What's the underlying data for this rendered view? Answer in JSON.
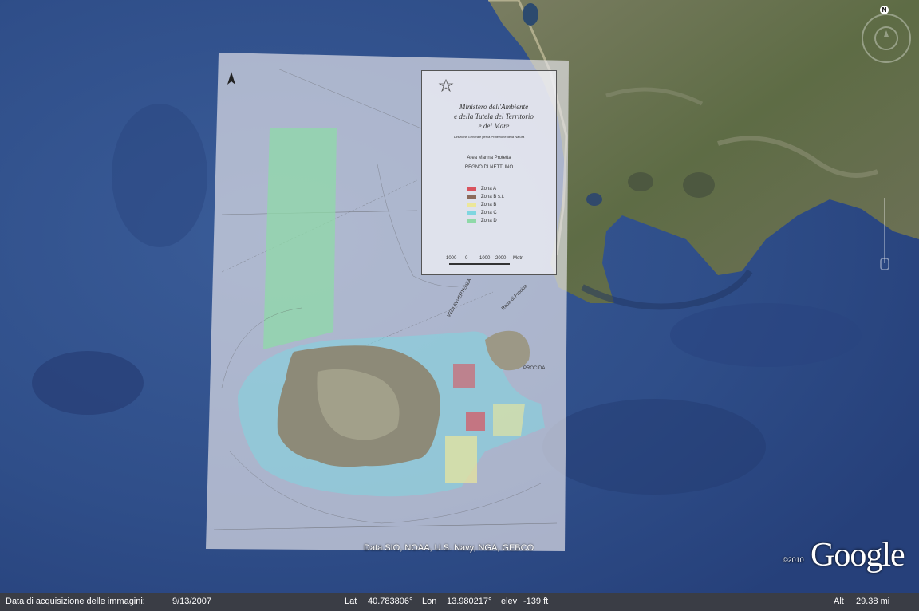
{
  "map": {
    "data_credit": "Data SIO, NOAA, U.S. Navy, NGA, GEBCO",
    "copyright_year": "©2010",
    "brand_logo": "Google",
    "compass_north": "N"
  },
  "nautical_chart": {
    "ministry_title_lines": [
      "Ministero dell'Ambiente",
      "e della Tutela del Territorio",
      "e del Mare"
    ],
    "directorate": "Direzione Generale per la Protezione della Natura",
    "area_label": "Area Marina Protetta",
    "area_name": "REGNO DI NETTUNO",
    "zones": [
      {
        "label": "Zona A",
        "color": "#d9535e"
      },
      {
        "label": "Zona B s.t.",
        "color": "#8b6a5a"
      },
      {
        "label": "Zona B",
        "color": "#ece79a"
      },
      {
        "label": "Zona C",
        "color": "#7fd6e0"
      },
      {
        "label": "Zona D",
        "color": "#8fd9a8"
      }
    ],
    "scale_bar": {
      "ticks": [
        "1000",
        "0",
        "1000",
        "2000"
      ],
      "unit": "Metri"
    },
    "map_labels": [
      "VEDI AVVERTENZA",
      "Rada di Procida",
      "PROCIDA"
    ]
  },
  "statusbar": {
    "acquisition_label": "Data di acquisizione delle immagini:",
    "acquisition_date": "9/13/2007",
    "lat_label": "Lat",
    "lat_value": "40.783806°",
    "lon_label": "Lon",
    "lon_value": "13.980217°",
    "elev_label": "elev",
    "elev_value": "-139 ft",
    "alt_label": "Alt",
    "alt_value": "29.38 mi"
  },
  "colors": {
    "sea": "#2e4c86",
    "land": "#5c6b44",
    "chart_overlay": "#e6e4ea",
    "statusbar": "#3a3d45"
  }
}
